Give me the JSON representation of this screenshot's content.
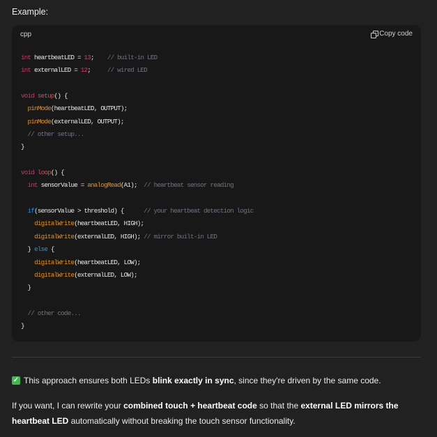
{
  "intro": "Example:",
  "code": {
    "language": "cpp",
    "copy_label": "Copy code",
    "lines": [
      [
        [
          "int",
          "kw"
        ],
        [
          " heartbeatLED = ",
          ""
        ],
        [
          "13",
          "num"
        ],
        [
          ";    ",
          ""
        ],
        [
          "// built-in LED",
          "cm"
        ]
      ],
      [
        [
          "int",
          "kw"
        ],
        [
          " externalLED = ",
          ""
        ],
        [
          "12",
          "num"
        ],
        [
          ";     ",
          ""
        ],
        [
          "// wired LED",
          "cm"
        ]
      ],
      [],
      [
        [
          "void",
          "kw"
        ],
        [
          " ",
          ""
        ],
        [
          "setup",
          "fn"
        ],
        [
          "() {",
          ""
        ]
      ],
      [
        [
          "  ",
          ""
        ],
        [
          "pinMode",
          "call"
        ],
        [
          "(heartbeatLED, OUTPUT);",
          ""
        ]
      ],
      [
        [
          "  ",
          ""
        ],
        [
          "pinMode",
          "call"
        ],
        [
          "(externalLED, OUTPUT);",
          ""
        ]
      ],
      [
        [
          "  ",
          ""
        ],
        [
          "// other setup...",
          "cm"
        ]
      ],
      [
        [
          "}",
          ""
        ]
      ],
      [],
      [
        [
          "void",
          "kw"
        ],
        [
          " ",
          ""
        ],
        [
          "loop",
          "fn"
        ],
        [
          "() {",
          ""
        ]
      ],
      [
        [
          "  ",
          ""
        ],
        [
          "int",
          "kw"
        ],
        [
          " sensorValue = ",
          ""
        ],
        [
          "analogRead",
          "call"
        ],
        [
          "(A1);  ",
          ""
        ],
        [
          "// heartbeat sensor reading",
          "cm"
        ]
      ],
      [],
      [
        [
          "  ",
          ""
        ],
        [
          "if",
          "ctl"
        ],
        [
          "(sensorValue > threshold) {      ",
          ""
        ],
        [
          "// your heartbeat detection logic",
          "cm"
        ]
      ],
      [
        [
          "    ",
          ""
        ],
        [
          "digitalWrite",
          "call"
        ],
        [
          "(heartbeatLED, HIGH);",
          ""
        ]
      ],
      [
        [
          "    ",
          ""
        ],
        [
          "digitalWrite",
          "call"
        ],
        [
          "(externalLED, HIGH); ",
          ""
        ],
        [
          "// mirror built-in LED",
          "cm"
        ]
      ],
      [
        [
          "  } ",
          ""
        ],
        [
          "else",
          "ctl"
        ],
        [
          " {",
          ""
        ]
      ],
      [
        [
          "    ",
          ""
        ],
        [
          "digitalWrite",
          "call"
        ],
        [
          "(heartbeatLED, LOW);",
          ""
        ]
      ],
      [
        [
          "    ",
          ""
        ],
        [
          "digitalWrite",
          "call"
        ],
        [
          "(externalLED, LOW);",
          ""
        ]
      ],
      [
        [
          "  }",
          ""
        ]
      ],
      [],
      [
        [
          "  ",
          ""
        ],
        [
          "// other code...",
          "cm"
        ]
      ],
      [
        [
          "}",
          ""
        ]
      ]
    ]
  },
  "summary": {
    "icon": "check-mark-button-icon",
    "pre": "This approach ensures both LEDs ",
    "bold": "blink exactly in sync",
    "post": ", since they're driven by the same code."
  },
  "offer": {
    "t1": "If you want, I can rewrite your ",
    "b1": "combined touch + heartbeat code",
    "t2": " so that the ",
    "b2": "external LED mirrors the heartbeat LED",
    "t3": " automatically without breaking the touch sensor functionality."
  },
  "colors": {
    "background": "#212121",
    "code_background": "#181818",
    "keyword": "#d6336c",
    "function_call": "#e69319",
    "control": "#3b8fd0",
    "comment": "#6e7681",
    "check": "#3fb950"
  }
}
